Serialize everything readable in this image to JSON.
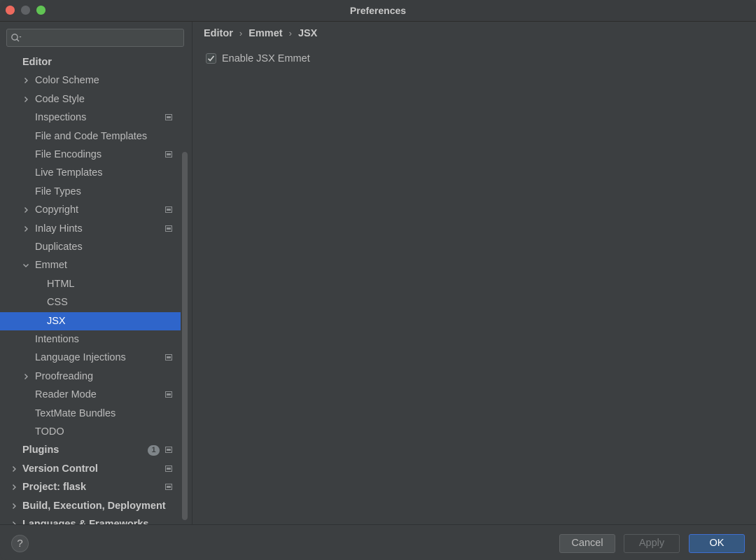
{
  "window": {
    "title": "Preferences"
  },
  "search": {
    "placeholder": "",
    "value": ""
  },
  "tree": [
    {
      "label": "Editor",
      "level": 0,
      "bold": true,
      "chevron": "none"
    },
    {
      "label": "Color Scheme",
      "level": 1,
      "chevron": "right"
    },
    {
      "label": "Code Style",
      "level": 1,
      "chevron": "right"
    },
    {
      "label": "Inspections",
      "level": 1,
      "chevron": "none",
      "project_icon": true
    },
    {
      "label": "File and Code Templates",
      "level": 1,
      "chevron": "none"
    },
    {
      "label": "File Encodings",
      "level": 1,
      "chevron": "none",
      "project_icon": true
    },
    {
      "label": "Live Templates",
      "level": 1,
      "chevron": "none"
    },
    {
      "label": "File Types",
      "level": 1,
      "chevron": "none"
    },
    {
      "label": "Copyright",
      "level": 1,
      "chevron": "right",
      "project_icon": true
    },
    {
      "label": "Inlay Hints",
      "level": 1,
      "chevron": "right",
      "project_icon": true
    },
    {
      "label": "Duplicates",
      "level": 1,
      "chevron": "none"
    },
    {
      "label": "Emmet",
      "level": 1,
      "chevron": "down"
    },
    {
      "label": "HTML",
      "level": 2,
      "chevron": "none"
    },
    {
      "label": "CSS",
      "level": 2,
      "chevron": "none"
    },
    {
      "label": "JSX",
      "level": 2,
      "chevron": "none",
      "selected": true
    },
    {
      "label": "Intentions",
      "level": 1,
      "chevron": "none"
    },
    {
      "label": "Language Injections",
      "level": 1,
      "chevron": "none",
      "project_icon": true
    },
    {
      "label": "Proofreading",
      "level": 1,
      "chevron": "right"
    },
    {
      "label": "Reader Mode",
      "level": 1,
      "chevron": "none",
      "project_icon": true
    },
    {
      "label": "TextMate Bundles",
      "level": 1,
      "chevron": "none"
    },
    {
      "label": "TODO",
      "level": 1,
      "chevron": "none"
    },
    {
      "label": "Plugins",
      "level": 0,
      "bold": true,
      "chevron": "none",
      "badge": "1",
      "project_icon": true
    },
    {
      "label": "Version Control",
      "level": 0,
      "bold": true,
      "chevron": "right",
      "project_icon": true
    },
    {
      "label": "Project: flask",
      "level": 0,
      "bold": true,
      "chevron": "right",
      "project_icon": true
    },
    {
      "label": "Build, Execution, Deployment",
      "level": 0,
      "bold": true,
      "chevron": "right"
    },
    {
      "label": "Languages & Frameworks",
      "level": 0,
      "bold": true,
      "chevron": "right"
    }
  ],
  "breadcrumb": [
    "Editor",
    "Emmet",
    "JSX"
  ],
  "breadcrumb_separator": "›",
  "settings": {
    "enable_jsx_emmet": {
      "label": "Enable JSX Emmet",
      "checked": true
    }
  },
  "footer": {
    "help_label": "?",
    "cancel_label": "Cancel",
    "apply_label": "Apply",
    "ok_label": "OK"
  },
  "colors": {
    "background": "#3c3f41",
    "selection": "#2f65ca",
    "ok_button": "#365880",
    "text": "#bbbbbb"
  }
}
